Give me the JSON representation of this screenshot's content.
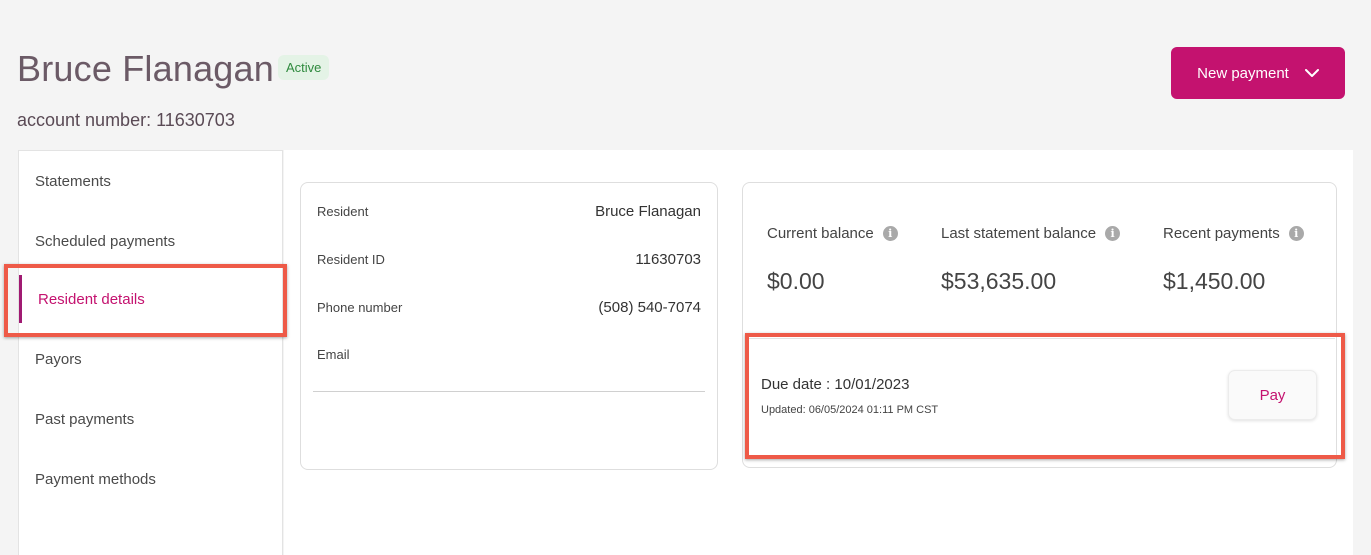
{
  "header": {
    "name": "Bruce Flanagan",
    "status": "Active",
    "account_number": "account number: 11630703",
    "new_payment_label": "New payment"
  },
  "sidebar": {
    "items": [
      {
        "label": "Statements"
      },
      {
        "label": "Scheduled payments"
      },
      {
        "label": "Resident details",
        "active": true
      },
      {
        "label": "Payors"
      },
      {
        "label": "Past payments"
      },
      {
        "label": "Payment methods"
      }
    ]
  },
  "resident": {
    "rows": [
      {
        "label": "Resident",
        "value": "Bruce Flanagan"
      },
      {
        "label": "Resident ID",
        "value": "11630703"
      },
      {
        "label": "Phone number",
        "value": "(508) 540-7074"
      },
      {
        "label": "Email",
        "value": ""
      }
    ]
  },
  "balances": {
    "columns": [
      {
        "label": "Current balance",
        "value": "$0.00"
      },
      {
        "label": "Last statement balance",
        "value": "$53,635.00"
      },
      {
        "label": "Recent payments",
        "value": "$1,450.00"
      }
    ],
    "due_date": "Due date : 10/01/2023",
    "updated": "Updated: 06/05/2024 01:11 PM CST",
    "pay_label": "Pay"
  },
  "colors": {
    "brand": "#c4126f",
    "active_badge_bg": "#e4f3e6",
    "active_badge_text": "#2f8a3e",
    "highlight": "#ee5a48"
  },
  "icons": [
    "chevron-down-icon",
    "info-icon"
  ]
}
